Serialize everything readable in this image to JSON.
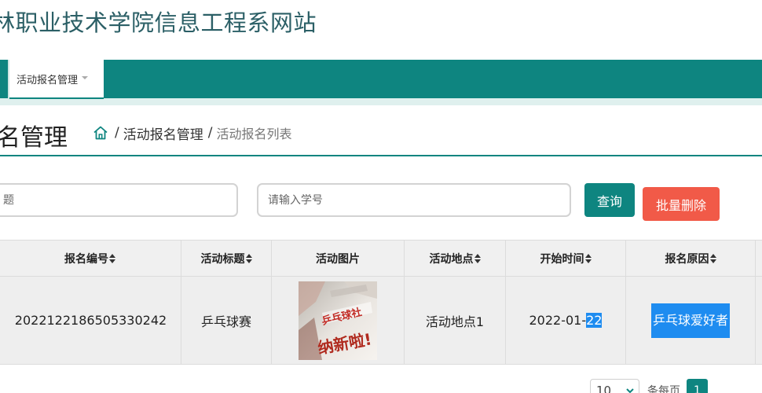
{
  "site": {
    "title": "林职业技术学院信息工程系网站"
  },
  "nav": {
    "items": [
      {
        "label": "活动报名管理"
      }
    ]
  },
  "page": {
    "heading": "名管理"
  },
  "breadcrumb": {
    "sep1": "/",
    "link": "活动报名管理",
    "sep2": "/",
    "current": "活动报名列表"
  },
  "search": {
    "title_placeholder": "题",
    "student_placeholder": "请输入学号",
    "search_label": "查询",
    "batch_delete_label": "批量删除"
  },
  "table": {
    "headers": [
      "报名编号",
      "活动标题",
      "活动图片",
      "活动地点",
      "开始时间",
      "报名原因"
    ],
    "rows": [
      {
        "reg_no": "2022122186505330242",
        "title": "乒乓球赛",
        "image_text": [
          "乒乓球社",
          "纳新啦!"
        ],
        "location": "活动地点1",
        "start_time_prefix": "2022-01-",
        "start_time_selected": "22",
        "reason": "乒乓球爱好者"
      }
    ]
  },
  "pager": {
    "page_size": "10",
    "per_page_label": "条每页",
    "current_page": "1"
  },
  "colors": {
    "brand": "#0e8580",
    "danger": "#f15a48",
    "selection": "#1e8cf0"
  }
}
